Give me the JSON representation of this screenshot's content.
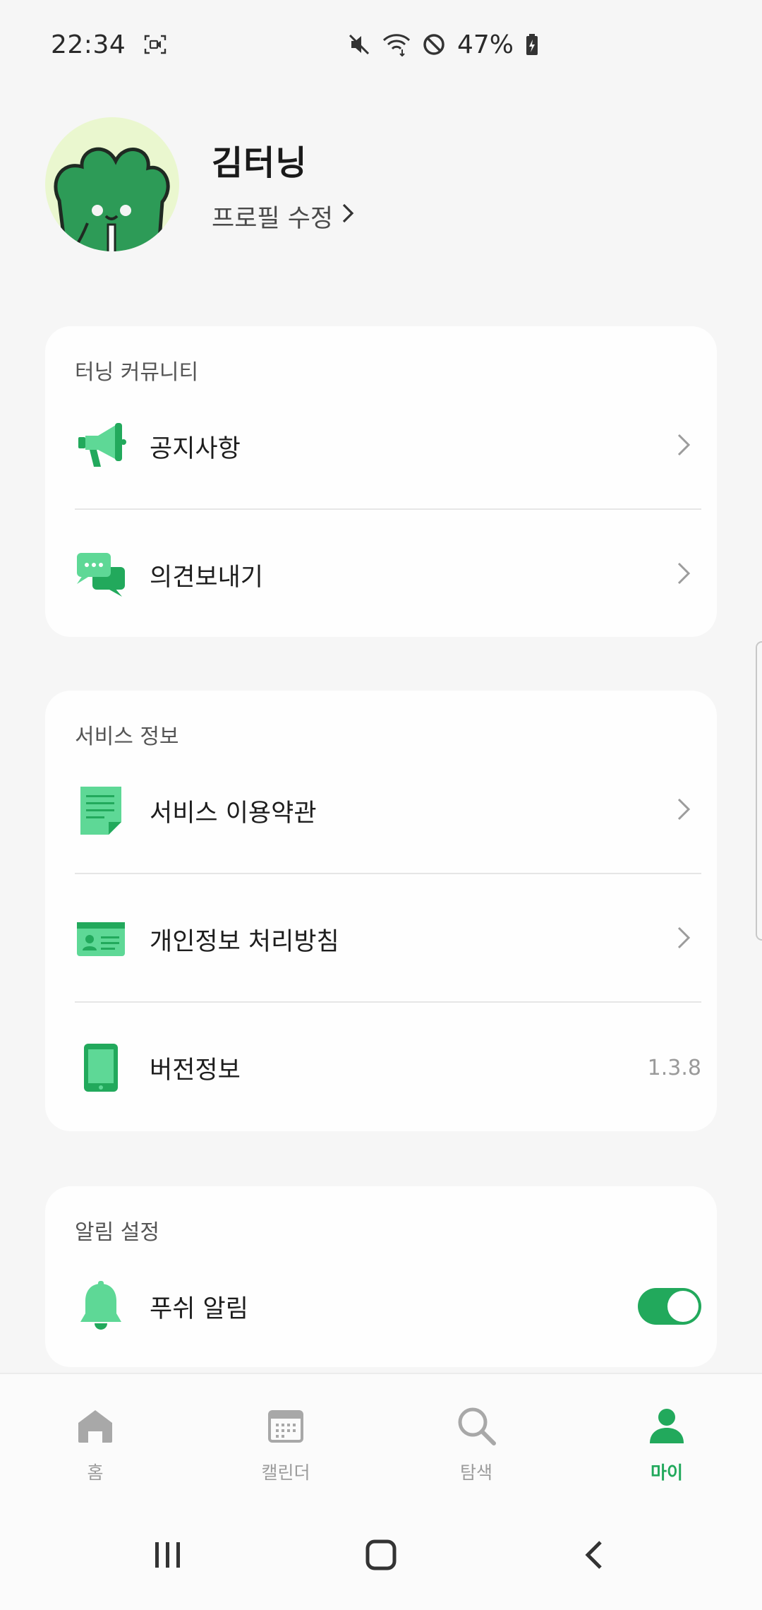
{
  "status_bar": {
    "time": "22:34",
    "battery": "47%",
    "icons": [
      "screen-record-icon",
      "mute-icon",
      "wifi-icon",
      "do-not-disturb-icon",
      "battery-charging-icon"
    ]
  },
  "profile": {
    "name": "김터닝",
    "edit_label": "프로필 수정"
  },
  "community": {
    "title": "터닝 커뮤니티",
    "items": [
      {
        "label": "공지사항",
        "icon": "megaphone-icon"
      },
      {
        "label": "의견보내기",
        "icon": "chat-bubbles-icon"
      }
    ]
  },
  "service_info": {
    "title": "서비스 정보",
    "items": [
      {
        "label": "서비스 이용약관",
        "icon": "document-icon"
      },
      {
        "label": "개인정보 처리방침",
        "icon": "id-card-icon"
      },
      {
        "label": "버전정보",
        "icon": "phone-icon",
        "value": "1.3.8"
      }
    ]
  },
  "notification": {
    "title": "알림 설정",
    "items": [
      {
        "label": "푸쉬 알림",
        "icon": "bell-icon",
        "toggle_on": true
      }
    ]
  },
  "bottom_nav": {
    "items": [
      {
        "label": "홈",
        "icon": "home-icon",
        "active": false
      },
      {
        "label": "캘린더",
        "icon": "calendar-icon",
        "active": false
      },
      {
        "label": "탐색",
        "icon": "search-icon",
        "active": false
      },
      {
        "label": "마이",
        "icon": "person-icon",
        "active": true
      }
    ]
  },
  "colors": {
    "accent": "#22a95c",
    "icon_green": "#5ed896",
    "background": "#f6f6f6",
    "card": "#fefefe"
  }
}
